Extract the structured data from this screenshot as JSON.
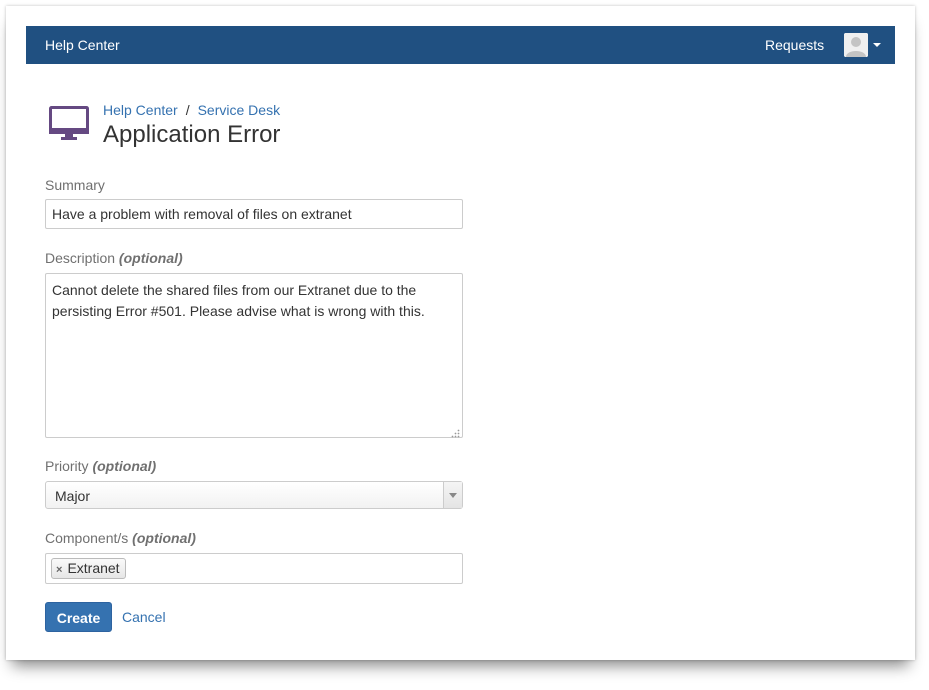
{
  "topbar": {
    "brand": "Help Center",
    "requests": "Requests",
    "avatar_icon": "user-avatar-icon",
    "menu_icon": "chevron-down-icon"
  },
  "header": {
    "icon": "monitor-icon",
    "breadcrumb": [
      "Help Center",
      "Service Desk"
    ],
    "breadcrumb_separator": "/",
    "title": "Application Error"
  },
  "form": {
    "summary": {
      "label": "Summary",
      "value": "Have a problem with removal of files on extranet"
    },
    "description": {
      "label": "Description",
      "optional": "(optional)",
      "value": "Cannot delete the shared files from our Extranet due to the persisting Error #501. Please advise what is wrong with this."
    },
    "priority": {
      "label": "Priority",
      "optional": "(optional)",
      "selected": "Major"
    },
    "components": {
      "label": "Component/s",
      "optional": "(optional)",
      "tokens": [
        {
          "remove_symbol": "×",
          "label": "Extranet"
        }
      ]
    }
  },
  "actions": {
    "create": "Create",
    "cancel": "Cancel"
  },
  "colors": {
    "topbar_bg": "#205081",
    "link": "#3572b0",
    "primary_button": "#3572b0",
    "icon_purple": "#654982"
  }
}
